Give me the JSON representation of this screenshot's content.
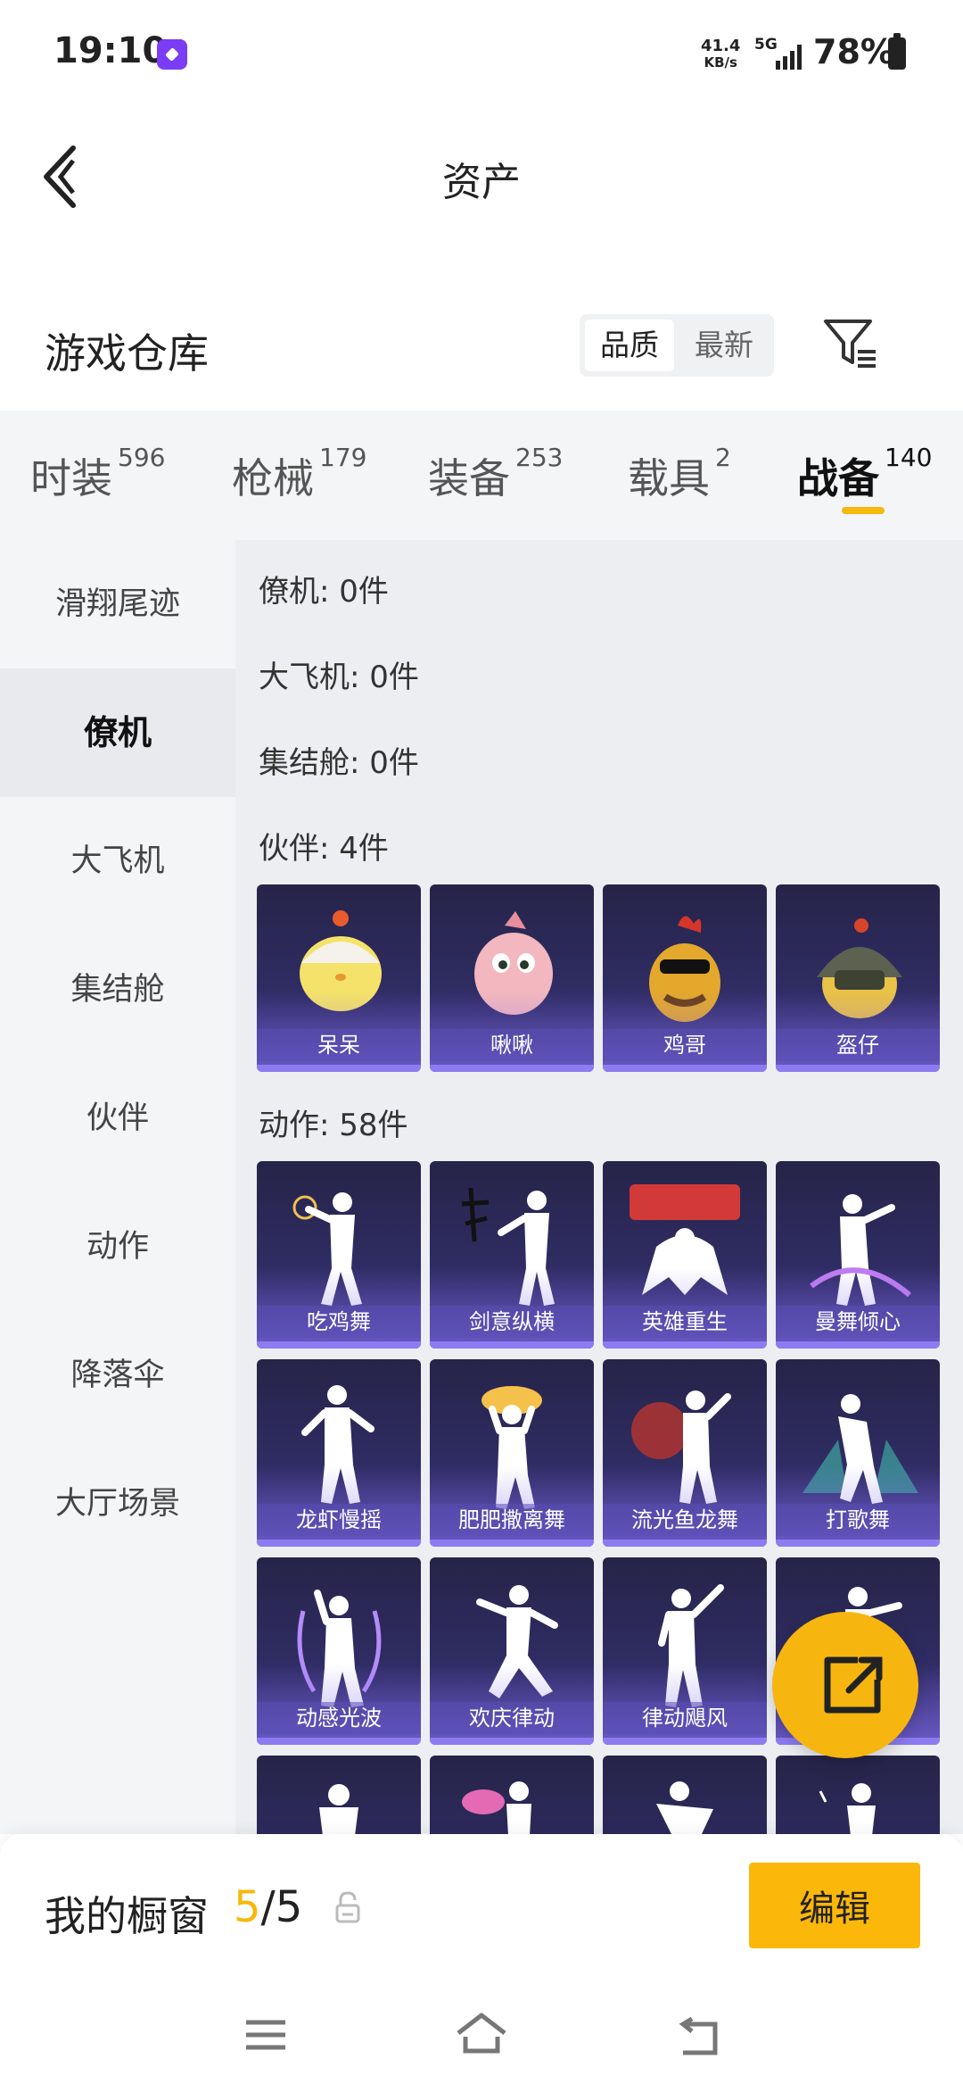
{
  "status_bar": {
    "time": "19:10",
    "net_speed_value": "41.4",
    "net_speed_unit": "KB/s",
    "network": "5G",
    "battery": "78%"
  },
  "header": {
    "title": "资产",
    "back_icon": "chevron-left-icon"
  },
  "warehouse": {
    "title": "游戏仓库",
    "sort_options": [
      "品质",
      "最新"
    ],
    "active_sort": "品质",
    "filter_icon": "filter-icon"
  },
  "tabs": [
    {
      "label": "时装",
      "count": "596"
    },
    {
      "label": "枪械",
      "count": "179"
    },
    {
      "label": "装备",
      "count": "253"
    },
    {
      "label": "载具",
      "count": "2"
    },
    {
      "label": "战备",
      "count": "140",
      "active": true
    }
  ],
  "sidebar": {
    "items": [
      "滑翔尾迹",
      "僚机",
      "大飞机",
      "集结舱",
      "伙伴",
      "动作",
      "降落伞",
      "大厅场景"
    ],
    "active": "僚机"
  },
  "content": {
    "groups": [
      {
        "label": "僚机: 0件"
      },
      {
        "label": "大飞机: 0件"
      },
      {
        "label": "集结舱: 0件"
      },
      {
        "label": "伙伴: 4件",
        "items": [
          "呆呆",
          "啾啾",
          "鸡哥",
          "盔仔"
        ]
      },
      {
        "label": "动作: 58件",
        "items": [
          "吃鸡舞",
          "剑意纵横",
          "英雄重生",
          "曼舞倾心",
          "龙虾慢摇",
          "肥肥撒离舞",
          "流光鱼龙舞",
          "打歌舞",
          "动感光波",
          "欢庆律动",
          "律动飓风"
        ]
      }
    ]
  },
  "fab": {
    "icon": "share-icon"
  },
  "showcase": {
    "label": "我的橱窗",
    "current": "5",
    "separator": "/",
    "total": "5",
    "lock_icon": "lock-icon",
    "edit_label": "编辑"
  },
  "colors": {
    "accent": "#f6b80c",
    "card_bg": "#2f2c63"
  }
}
